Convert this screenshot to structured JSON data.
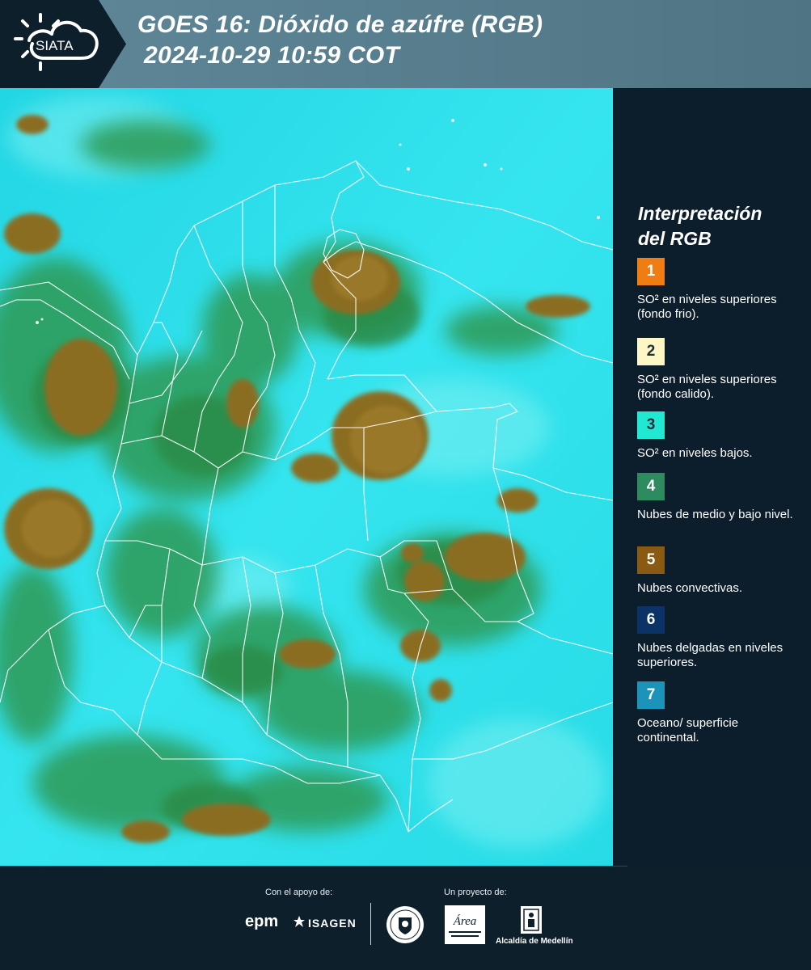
{
  "header": {
    "logo_text": "SIATA",
    "title_line1": "GOES 16: Dióxido de azúfre (RGB)",
    "title_line2": "2024-10-29 10:59 COT"
  },
  "legend": {
    "title_line1": "Interpretación",
    "title_line2": "del RGB",
    "items": [
      {
        "number": "1",
        "color": "#f07d14",
        "text": "SO² en niveles superiores (fondo frio)."
      },
      {
        "number": "2",
        "color": "#fdf6c6",
        "text": "SO² en niveles superiores (fondo calido)."
      },
      {
        "number": "3",
        "color": "#21e8d2",
        "text": "SO² en niveles bajos."
      },
      {
        "number": "4",
        "color": "#2e8a5f",
        "text": "Nubes de medio y bajo nivel."
      },
      {
        "number": "5",
        "color": "#8a5a12",
        "text": "Nubes convectivas."
      },
      {
        "number": "6",
        "color": "#0c3366",
        "text": "Nubes delgadas en niveles superiores."
      },
      {
        "number": "7",
        "color": "#1c93b8",
        "text": "Oceano/ superficie continental."
      }
    ]
  },
  "footer": {
    "support_label": "Con el apoyo de:",
    "project_label": "Un proyecto de:",
    "epm": "epm",
    "isagen": "ISAGEN",
    "metropolitana": "Área",
    "alcaldia": "Alcaldía de Medellín"
  },
  "colors": {
    "background": "#0d1e2a",
    "header_band": "#5d8595",
    "map_cyan": "#27dde7",
    "cloud_brown": "#8a6e25",
    "cloud_green": "#2f9a52"
  }
}
